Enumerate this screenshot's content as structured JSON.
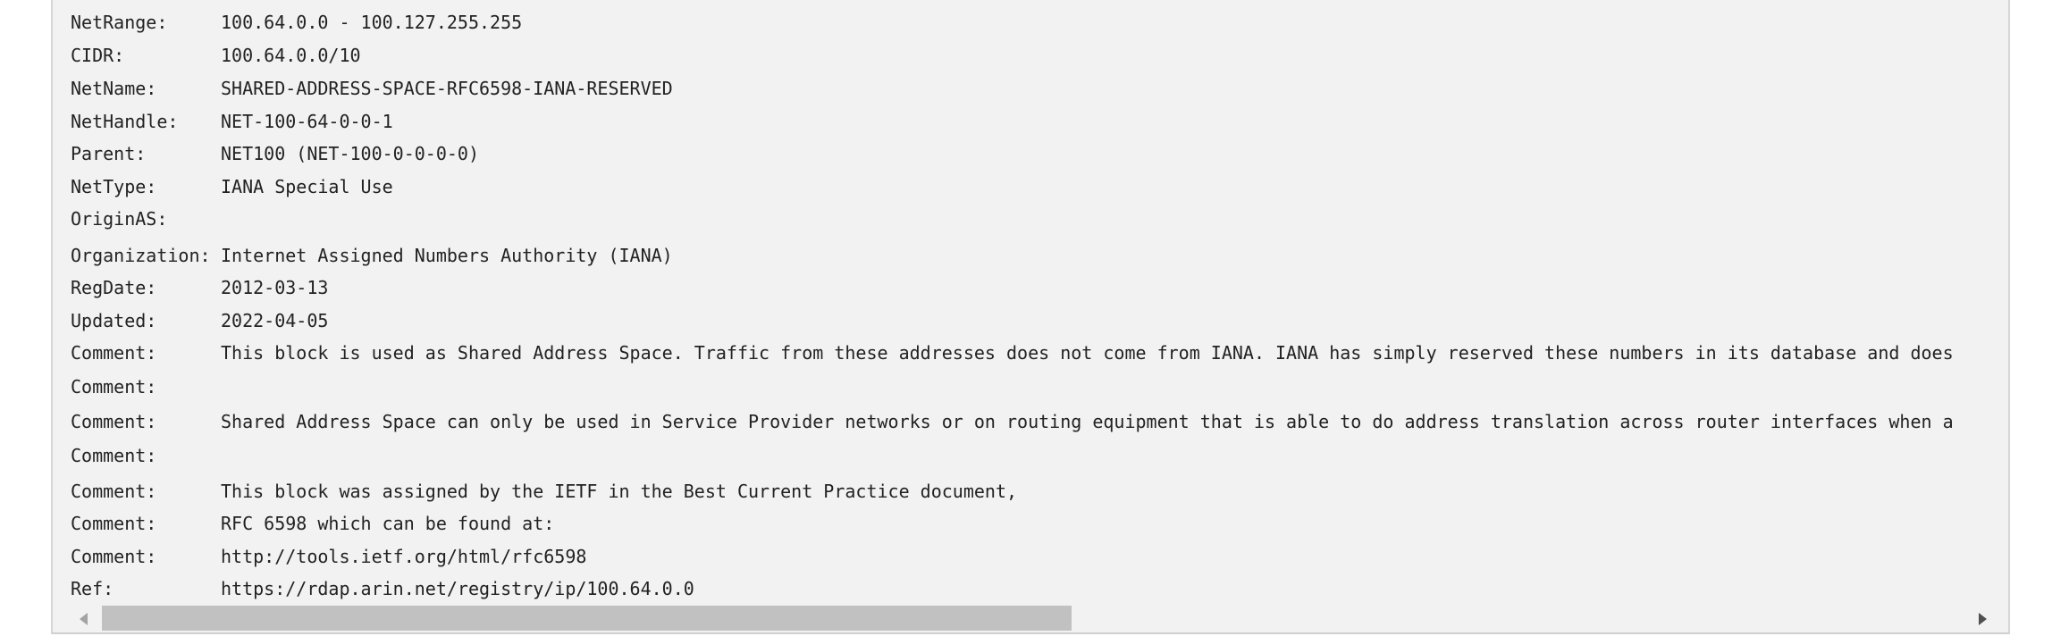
{
  "whois": {
    "rows": [
      {
        "key": "NetRange:",
        "value": "100.64.0.0 - 100.127.255.255"
      },
      {
        "key": "CIDR:",
        "value": "100.64.0.0/10"
      },
      {
        "key": "NetName:",
        "value": "SHARED-ADDRESS-SPACE-RFC6598-IANA-RESERVED"
      },
      {
        "key": "NetHandle:",
        "value": "NET-100-64-0-0-1"
      },
      {
        "key": "Parent:",
        "value": "NET100 (NET-100-0-0-0-0)"
      },
      {
        "key": "NetType:",
        "value": "IANA Special Use"
      },
      {
        "key": "OriginAS:",
        "value": ""
      },
      {
        "key": "Organization:",
        "value": "Internet Assigned Numbers Authority (IANA)"
      },
      {
        "key": "RegDate:",
        "value": "2012-03-13"
      },
      {
        "key": "Updated:",
        "value": "2022-04-05"
      },
      {
        "key": "Comment:",
        "value": "This block is used as Shared Address Space. Traffic from these addresses does not come from IANA. IANA has simply reserved these numbers in its database and does"
      },
      {
        "key": "Comment:",
        "value": ""
      },
      {
        "key": "Comment:",
        "value": "Shared Address Space can only be used in Service Provider networks or on routing equipment that is able to do address translation across router interfaces when a"
      },
      {
        "key": "Comment:",
        "value": ""
      },
      {
        "key": "Comment:",
        "value": "This block was assigned by the IETF in the Best Current Practice document,"
      },
      {
        "key": "Comment:",
        "value": "RFC 6598 which can be found at:"
      },
      {
        "key": "Comment:",
        "value": "http://tools.ietf.org/html/rfc6598"
      },
      {
        "key": "Ref:",
        "value": "https://rdap.arin.net/registry/ip/100.64.0.0"
      }
    ]
  },
  "scrollbar": {
    "left_arrow_icon": "triangle-left-icon",
    "right_arrow_icon": "triangle-right-icon",
    "thumb_fraction": 0.52
  }
}
